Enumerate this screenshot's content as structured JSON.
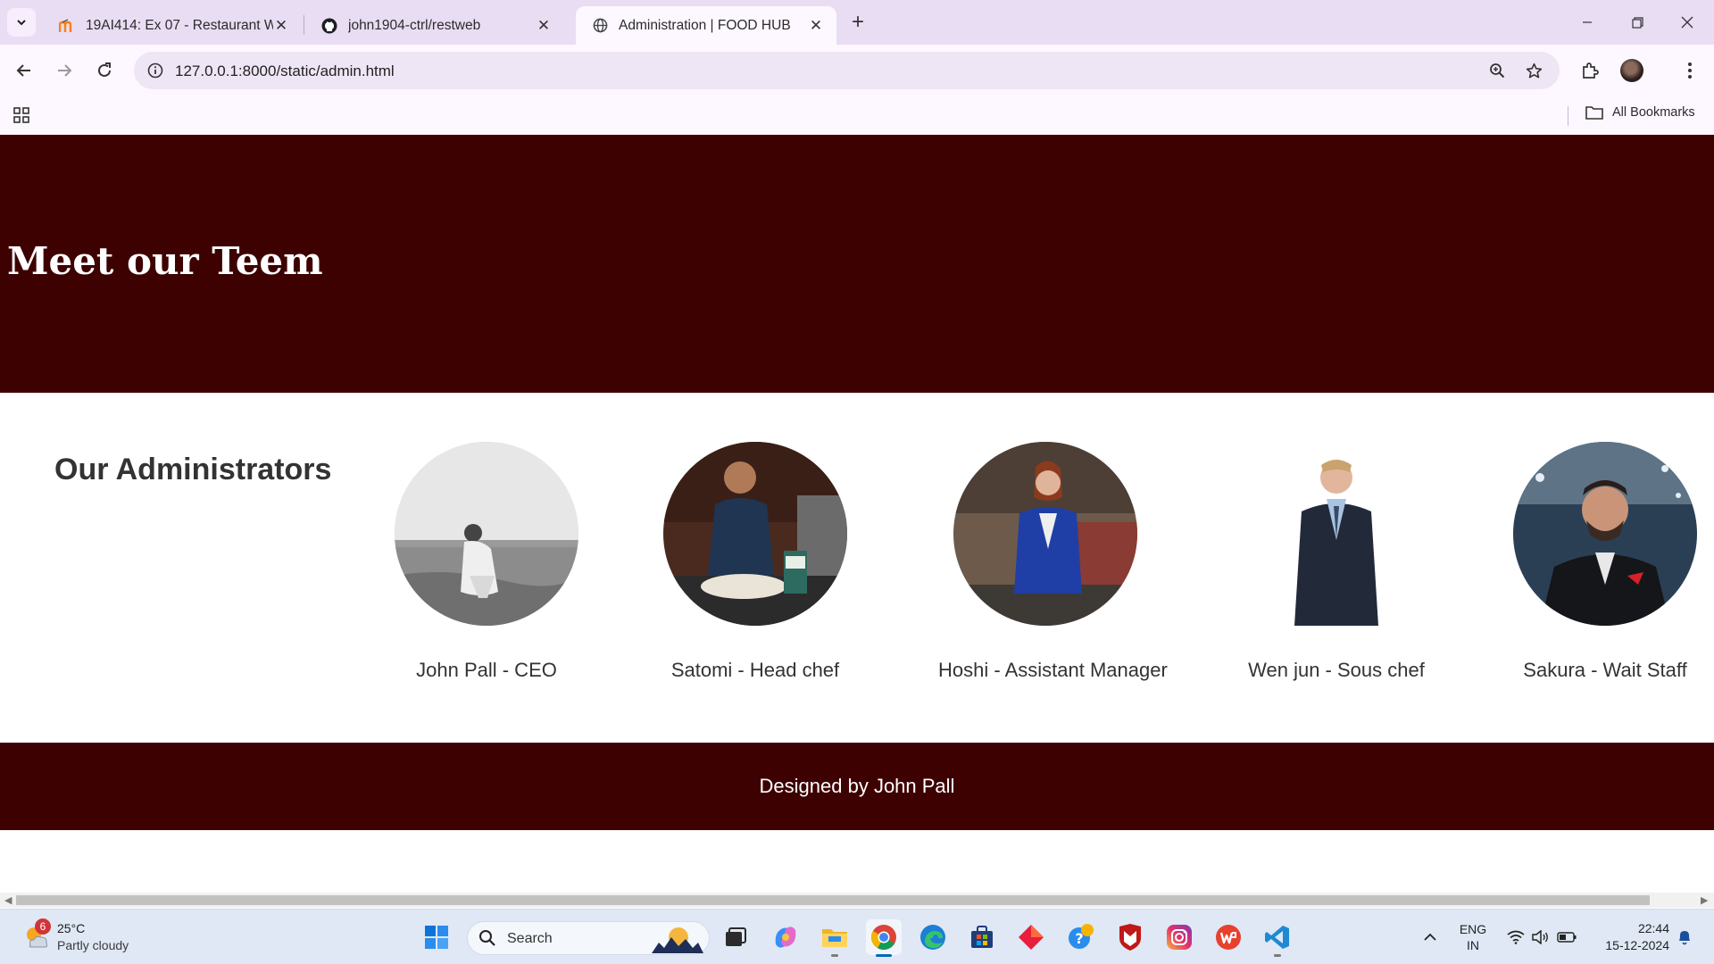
{
  "browser": {
    "tabs": [
      {
        "title": "19AI414: Ex 07 - Restaurant We",
        "icon": "moodle-icon",
        "active": false
      },
      {
        "title": "john1904-ctrl/restweb",
        "icon": "github-icon",
        "active": false
      },
      {
        "title": "Administration | FOOD HUB",
        "icon": "globe-icon",
        "active": true
      }
    ],
    "url": "127.0.0.1:8000/static/admin.html",
    "bookmarks_label": "All Bookmarks"
  },
  "page": {
    "hero_title": "Meet our Teem",
    "section_title": "Our Administrators",
    "team": [
      {
        "name": "John Pall - CEO",
        "photo": "grayscale-beach-portrait"
      },
      {
        "name": "Satomi - Head chef",
        "photo": "chef-cooking-portrait"
      },
      {
        "name": "Hoshi - Assistant Manager",
        "photo": "woman-blue-blazer-portrait"
      },
      {
        "name": "Wen jun - Sous chef",
        "photo": "man-navy-suit-portrait"
      },
      {
        "name": "Sakura - Wait Staff",
        "photo": "man-black-jacket-portrait"
      }
    ],
    "footer_text": "Designed by John Pall",
    "colors": {
      "brand_maroon": "#3e0102",
      "text_dark": "#333333"
    }
  },
  "taskbar": {
    "weather_badge": "6",
    "temperature": "25°C",
    "condition": "Partly cloudy",
    "search_placeholder": "Search",
    "language": "ENG",
    "region": "IN",
    "time": "22:44",
    "date": "15-12-2024"
  }
}
